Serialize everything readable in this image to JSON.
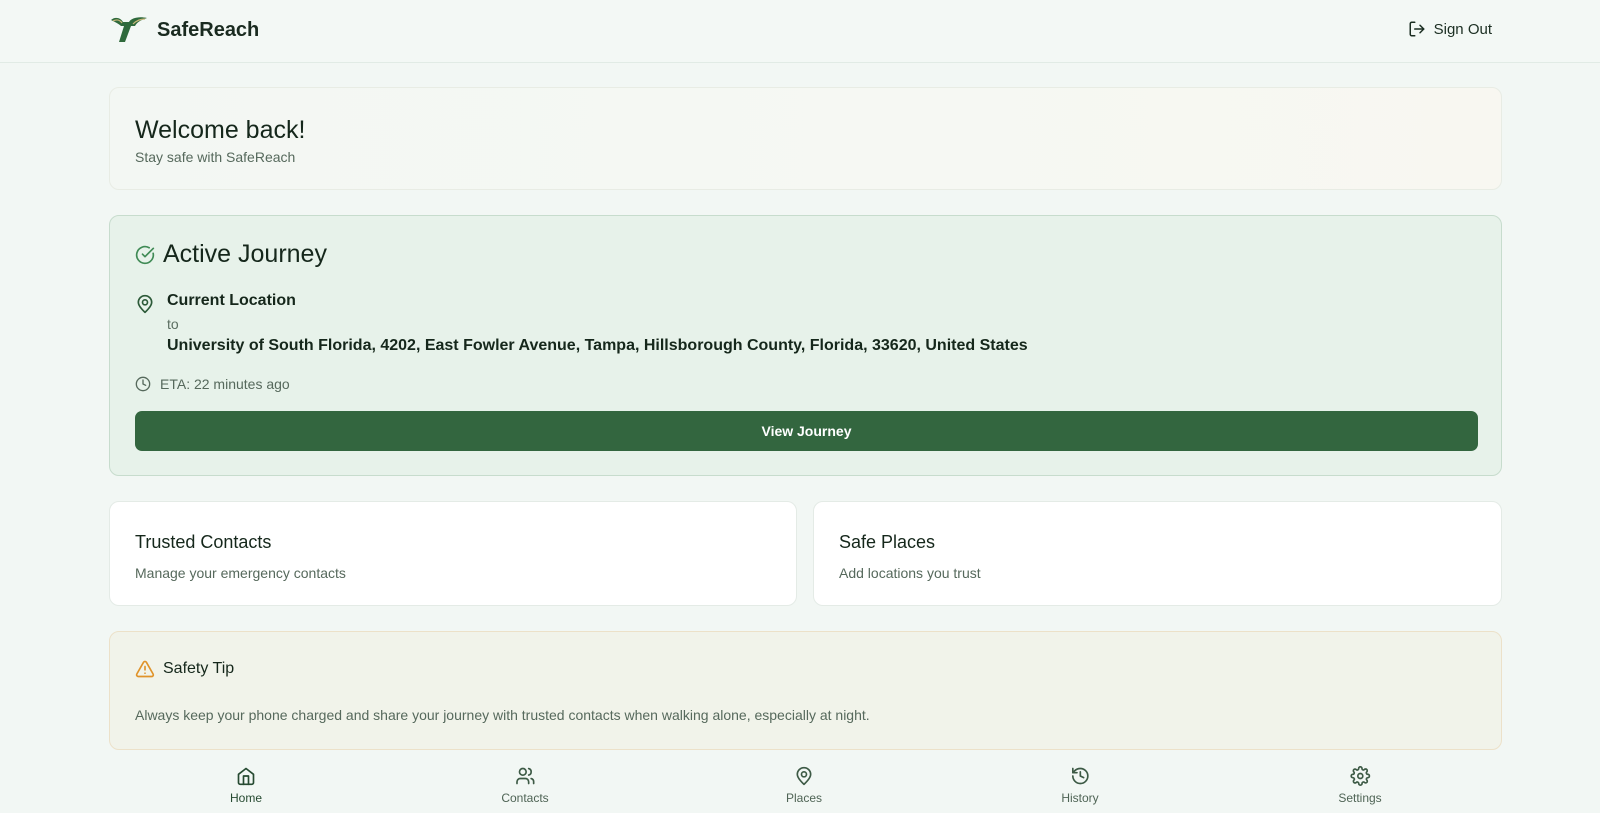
{
  "header": {
    "brand_name": "SafeReach",
    "logo_icon": "bull-horns-logo",
    "signout_label": "Sign Out",
    "signout_icon": "sign-out-icon"
  },
  "welcome": {
    "title": "Welcome back!",
    "subtitle": "Stay safe with SafeReach"
  },
  "journey": {
    "title": "Active Journey",
    "status_icon": "check-circle-icon",
    "from": "Current Location",
    "to_word": "to",
    "destination": "University of South Florida, 4202, East Fowler Avenue, Tampa, Hillsborough County, Florida, 33620, United States",
    "eta": "ETA: 22 minutes ago",
    "button_label": "View Journey"
  },
  "cards": {
    "contacts": {
      "title": "Trusted Contacts",
      "description": "Manage your emergency contacts"
    },
    "places": {
      "title": "Safe Places",
      "description": "Add locations you trust"
    }
  },
  "tip": {
    "title": "Safety Tip",
    "icon": "warning-triangle-icon",
    "text": "Always keep your phone charged and share your journey with trusted contacts when walking alone, especially at night."
  },
  "nav": {
    "items": [
      {
        "label": "Home",
        "icon": "home-icon",
        "active": true
      },
      {
        "label": "Contacts",
        "icon": "users-icon",
        "active": false
      },
      {
        "label": "Places",
        "icon": "map-pin-icon",
        "active": false
      },
      {
        "label": "History",
        "icon": "history-icon",
        "active": false
      },
      {
        "label": "Settings",
        "icon": "gear-icon",
        "active": false
      }
    ]
  },
  "colors": {
    "brand_green": "#33663f",
    "background": "#f2f7f4",
    "journey_bg": "#e7f2ea",
    "warning": "#e0932a"
  }
}
